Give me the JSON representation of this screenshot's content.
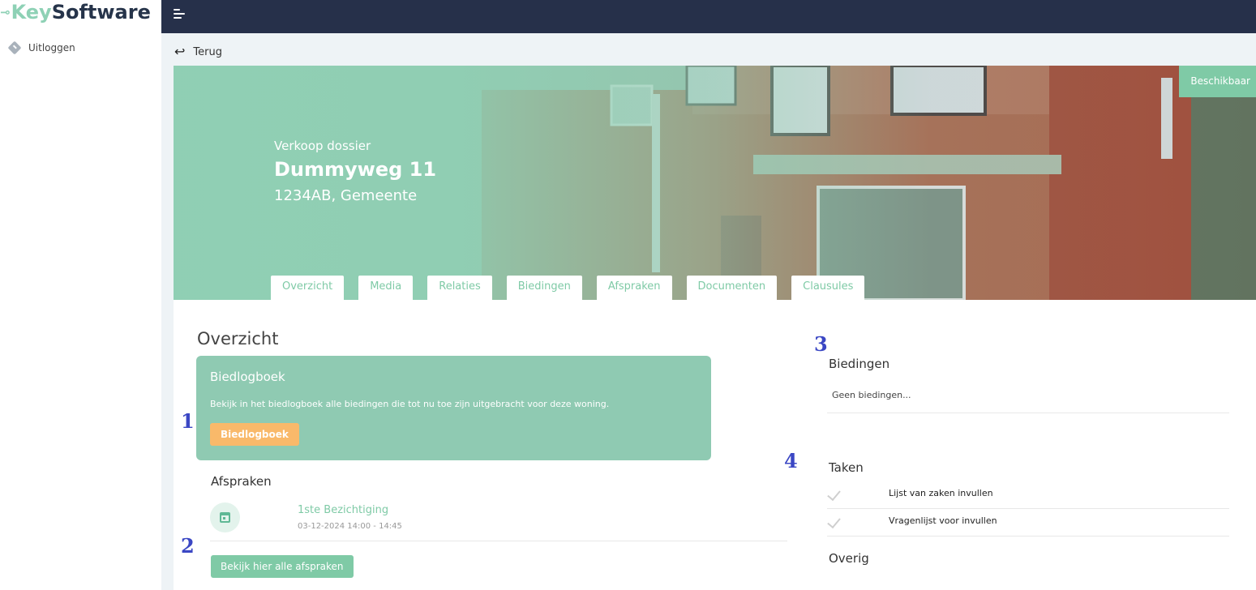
{
  "brand": {
    "logo_key": "Key",
    "logo_software": "Software"
  },
  "sidebar": {
    "logout_label": "Uitloggen"
  },
  "nav": {
    "back_label": "Terug"
  },
  "hero": {
    "kind": "Verkoop dossier",
    "street": "Dummyweg 11",
    "city": "1234AB, Gemeente",
    "status_badge": "Beschikbaar"
  },
  "tabs": [
    {
      "label": "Overzicht"
    },
    {
      "label": "Media"
    },
    {
      "label": "Relaties"
    },
    {
      "label": "Biedingen"
    },
    {
      "label": "Afspraken"
    },
    {
      "label": "Documenten"
    },
    {
      "label": "Clausules"
    }
  ],
  "overview": {
    "title": "Overzicht",
    "bidbook": {
      "title": "Biedlogboek",
      "text": "Bekijk in het biedlogboek alle biedingen die tot nu toe zijn uitgebracht voor deze woning.",
      "button": "Biedlogboek"
    },
    "appointments": {
      "title": "Afspraken",
      "items": [
        {
          "title": "1ste Bezichtiging",
          "time": "03-12-2024 14:00 - 14:45"
        }
      ],
      "all_button": "Bekijk hier alle afspraken"
    }
  },
  "bids": {
    "title": "Biedingen",
    "empty": "Geen biedingen..."
  },
  "tasks": {
    "title": "Taken",
    "items": [
      {
        "label": "Lijst van zaken invullen"
      },
      {
        "label": "Vragenlijst voor invullen"
      }
    ]
  },
  "other": {
    "title": "Overig"
  },
  "annotations": [
    "1",
    "2",
    "3",
    "4"
  ],
  "colors": {
    "topbar": "#26304a",
    "accent_green": "#7fcaa6",
    "card_green": "#8fcab2",
    "orange_button": "#f9b96a",
    "annotation_blue": "#3b47c4"
  }
}
